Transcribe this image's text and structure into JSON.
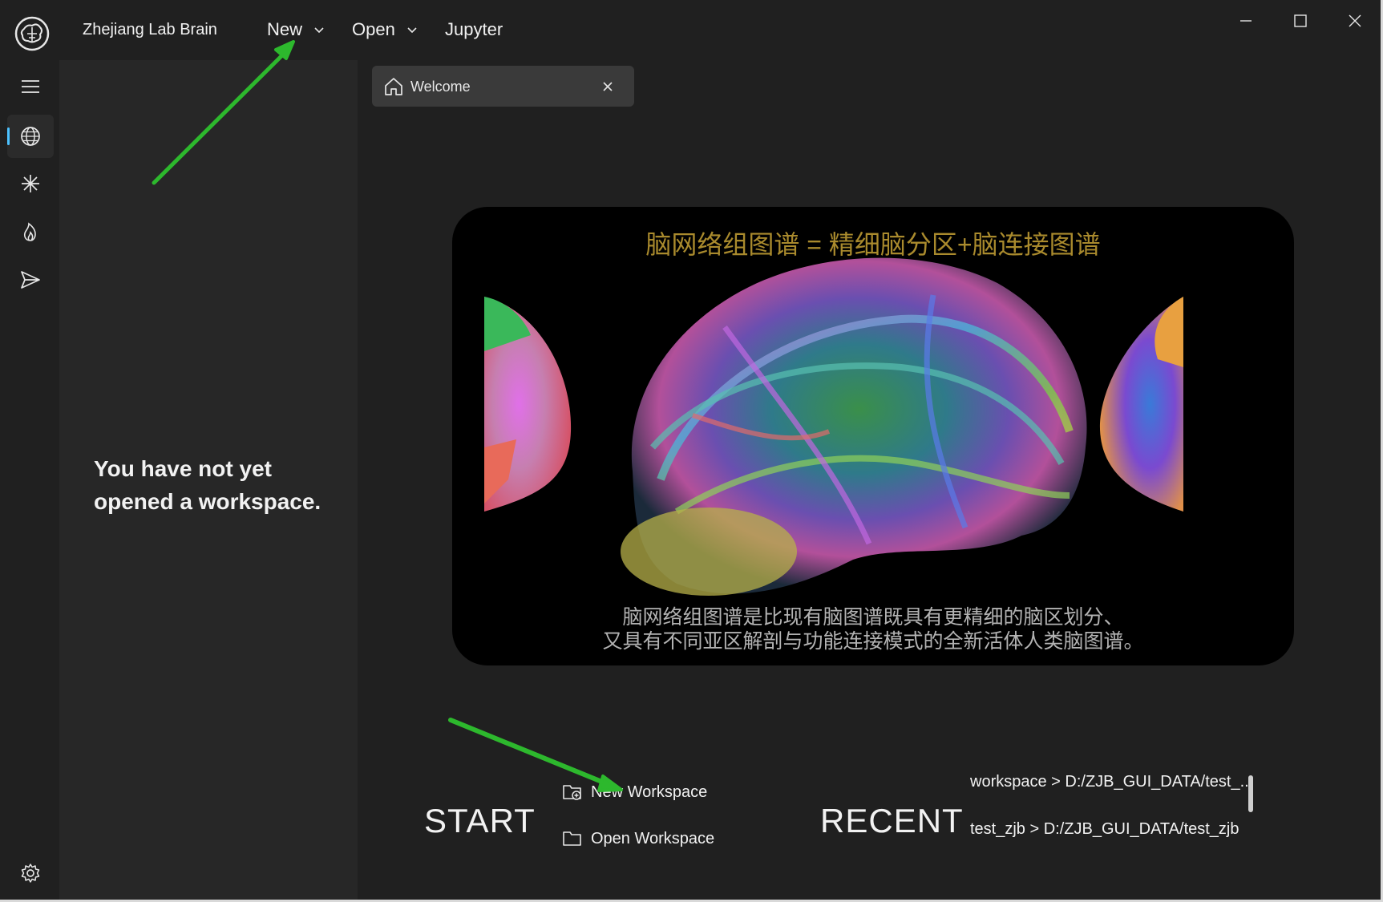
{
  "app": {
    "title": "Zhejiang Lab Brain"
  },
  "menubar": {
    "items": [
      {
        "label": "New",
        "has_dropdown": true
      },
      {
        "label": "Open",
        "has_dropdown": true
      },
      {
        "label": "Jupyter",
        "has_dropdown": false
      }
    ]
  },
  "window_controls": {
    "icons": [
      "minimize-icon",
      "maximize-icon",
      "close-icon"
    ]
  },
  "activity_bar": {
    "items": [
      {
        "icon": "hamburger-menu-icon"
      },
      {
        "icon": "globe-icon",
        "active": true
      },
      {
        "icon": "asterisk-icon"
      },
      {
        "icon": "flame-icon"
      },
      {
        "icon": "send-icon"
      }
    ],
    "bottom": {
      "icon": "gear-icon"
    }
  },
  "side_panel": {
    "empty_message_line1": "You have not yet",
    "empty_message_line2": "opened a workspace."
  },
  "tabs": [
    {
      "label": "Welcome",
      "icon": "home-icon",
      "closable": true
    }
  ],
  "banner": {
    "title": "脑网络组图谱 = 精细脑分区+脑连接图谱",
    "caption_line1": "脑网络组图谱是比现有脑图谱既具有更精细的脑区划分、",
    "caption_line2": "又具有不同亚区解剖与功能连接模式的全新活体人类脑图谱。"
  },
  "start": {
    "heading": "START",
    "links": [
      {
        "label": "New Workspace",
        "icon": "new-folder-icon"
      },
      {
        "label": "Open Workspace",
        "icon": "folder-icon"
      }
    ]
  },
  "recent": {
    "heading": "RECENT",
    "items": [
      "workspace > D:/ZJB_GUI_DATA/test_...",
      "test_zjb > D:/ZJB_GUI_DATA/test_zjb"
    ]
  },
  "colors": {
    "background": "#202020",
    "panel": "#272727",
    "tab": "#3a3a3a",
    "accent": "#4cc2ff",
    "annotation_arrow": "#2db82d"
  }
}
